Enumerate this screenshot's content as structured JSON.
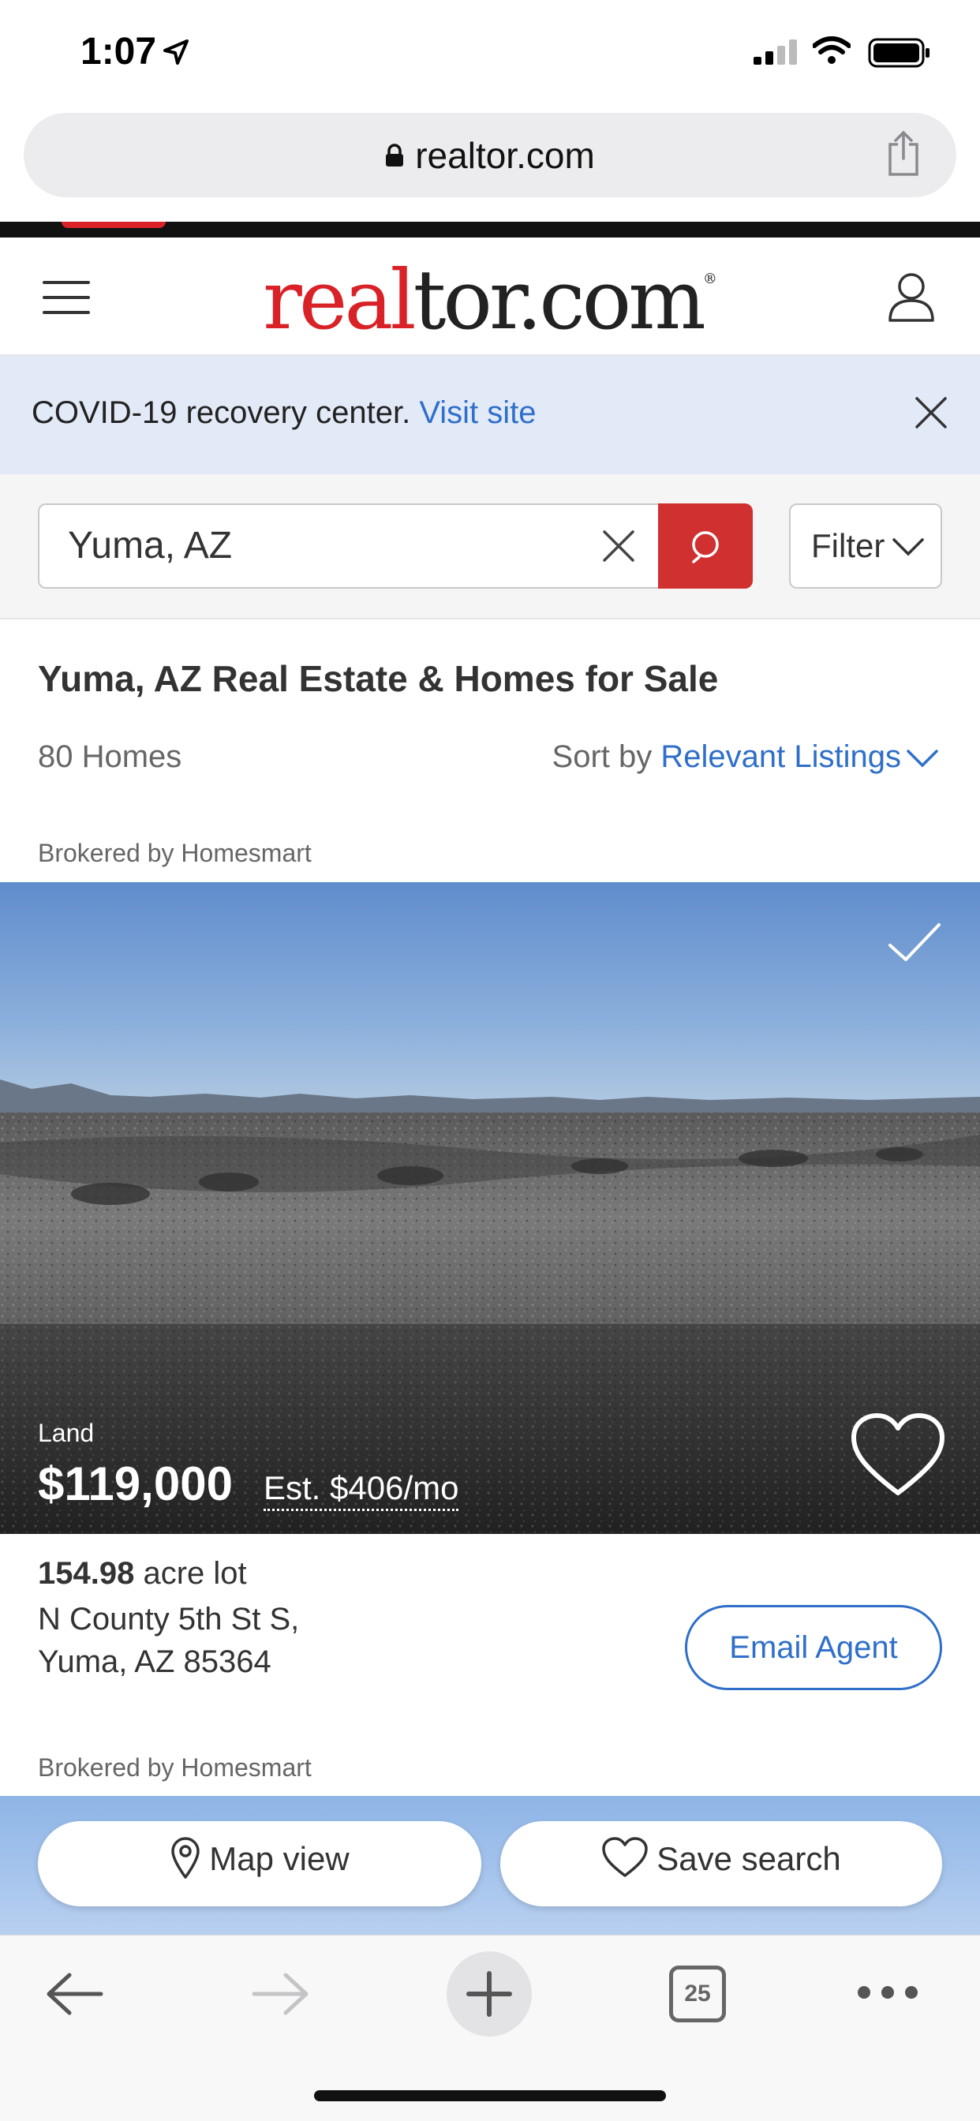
{
  "status_bar": {
    "time": "1:07"
  },
  "browser": {
    "url": "realtor.com",
    "open_tabs": "25"
  },
  "header": {
    "logo": {
      "part1": "real",
      "part2": "tor.com",
      "mark": "®"
    }
  },
  "banner": {
    "text": "COVID-19 recovery center.",
    "link": "Visit site"
  },
  "search": {
    "value": "Yuma, AZ",
    "filter_label": "Filter"
  },
  "results": {
    "title": "Yuma, AZ Real Estate & Homes for Sale",
    "count": "80 Homes",
    "sort_label": "Sort by",
    "sort_value": "Relevant Listings"
  },
  "listing": {
    "brokered_by": "Brokered by Homesmart",
    "type": "Land",
    "price": "$119,000",
    "est_payment": "Est. $406/mo",
    "lot_size": "154.98",
    "lot_unit": "acre lot",
    "address_line1": "N County 5th St S,",
    "address_line2": "Yuma, AZ 85364",
    "email_agent_label": "Email Agent"
  },
  "next_listing": {
    "brokered_by": "Brokered by Homesmart"
  },
  "bottom_actions": {
    "map_view": "Map view",
    "save_search": "Save search"
  },
  "colors": {
    "brand_red": "#d92228",
    "link_blue": "#2f6fc9",
    "banner_bg": "#e3eaf7"
  }
}
